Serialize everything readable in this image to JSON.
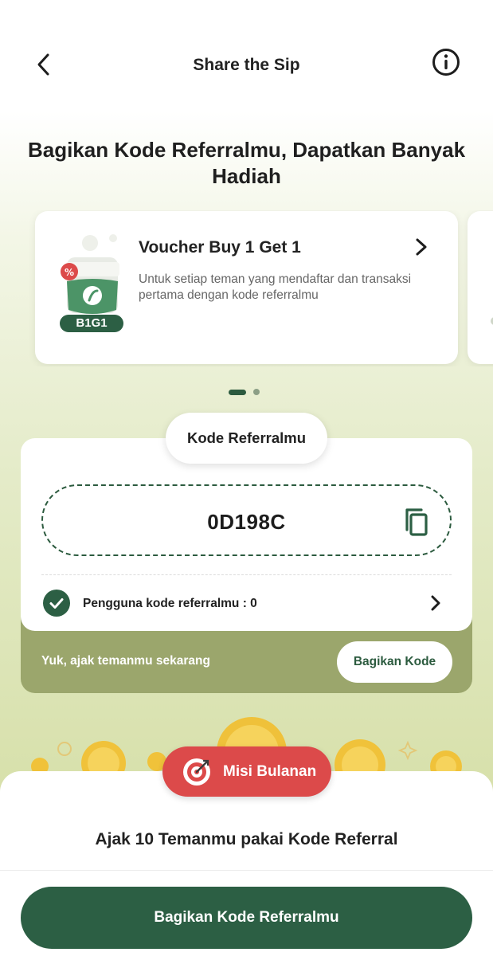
{
  "header": {
    "title": "Share the Sip",
    "back_icon": "chevron-left-icon",
    "info_icon": "info-circle-icon"
  },
  "hero": {
    "title": "Bagikan Kode Referralmu, Dapatkan Banyak Hadiah"
  },
  "carousel": {
    "cards": [
      {
        "title": "Voucher Buy 1 Get 1",
        "description": "Untuk setiap teman yang mendaftar dan transaksi pertama dengan kode referralmu",
        "badge": "B1G1",
        "arrow_icon": "chevron-right-icon"
      }
    ],
    "page_count": 2,
    "active_page": 1
  },
  "referral": {
    "label": "Kode Referralmu",
    "code": "0D198C",
    "copy_icon": "copy-icon",
    "users_label": "Pengguna kode referralmu : 0",
    "invite_text": "Yuk, ajak temanmu sekarang",
    "share_button": "Bagikan Kode"
  },
  "mission": {
    "pill_label": "Misi Bulanan",
    "title": "Ajak 10 Temanmu pakai Kode Referral"
  },
  "cta": {
    "label": "Bagikan Kode Referralmu"
  },
  "colors": {
    "primary_green": "#2c5f44",
    "olive_footer": "#9ba66c",
    "mission_red": "#dc4a4a",
    "coin_gold": "#f0c23a"
  }
}
